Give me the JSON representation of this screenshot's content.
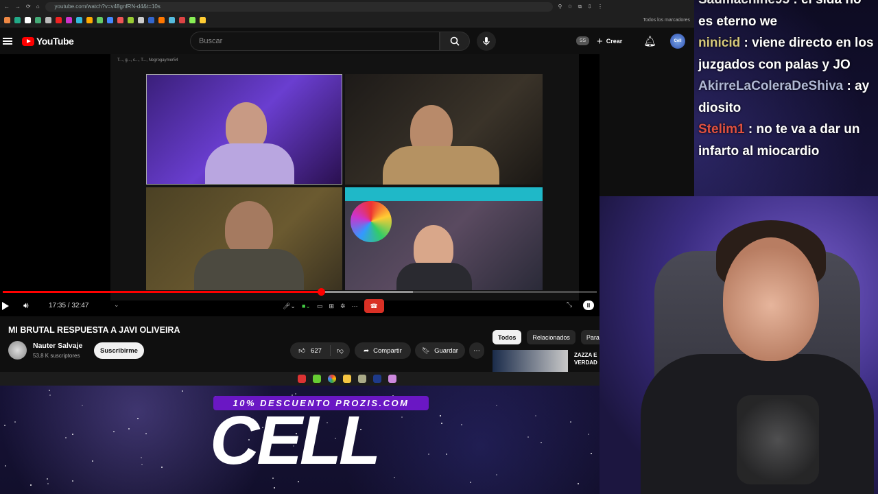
{
  "browser": {
    "url": "youtube.com/watch?v=v48gnfRN-d4&t=10s",
    "bookmarks_label": "Todos los marcadores"
  },
  "youtube": {
    "logo_text": "YouTube",
    "search_placeholder": "Buscar",
    "ss_badge": "SS",
    "create_label": "Crear",
    "account_avatar_text": "Cell"
  },
  "player": {
    "participants_text": "T..., g..., c..., T..., Negrogaymer54",
    "current_time": "17:35",
    "duration": "32:47",
    "time_display": "17:35 / 32:47",
    "progress_fraction": 0.536,
    "buffer_fraction": 0.69
  },
  "video": {
    "title": "MI BRUTAL RESPUESTA A JAVI OLIVEIRA",
    "channel_name": "Nauter Salvaje",
    "subscribers": "53,8 K suscriptores",
    "subscribe_label": "Suscribirme",
    "like_count": "627",
    "share_label": "Compartir",
    "save_label": "Guardar"
  },
  "related": {
    "chips": [
      "Todos",
      "Relacionados",
      "Para"
    ],
    "first_title_line1": "ZAZZA E",
    "first_title_line2": "VERDAD"
  },
  "chat": {
    "messages": [
      {
        "user": "Sadmachine95",
        "text": ": el sida no es eterno we"
      },
      {
        "user": "ninicid",
        "text": ": viene directo en los juzgados con palas y JO"
      },
      {
        "user": "AkirreLaColeraDeShiva",
        "text": ": ay diosito"
      },
      {
        "user": "Stelim1",
        "text": ": no te va a dar un infarto al miocardio"
      }
    ]
  },
  "promo": {
    "badge": "10% DESCUENTO PROZIS.COM",
    "big_text": "CELL"
  },
  "colors": {
    "youtube_red": "#ff0000",
    "promo_purple": "#6a17c4",
    "end_call_red": "#d93025"
  }
}
